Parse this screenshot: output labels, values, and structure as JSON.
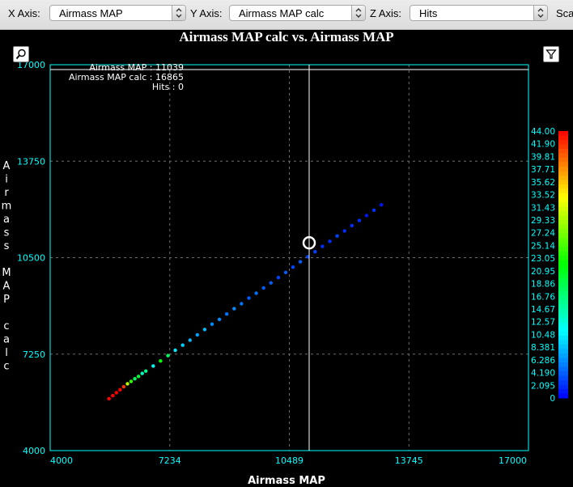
{
  "toolbar": {
    "x_label": "X Axis:",
    "x_value": "Airmass MAP",
    "y_label": "Y Axis:",
    "y_value": "Airmass MAP calc",
    "z_label": "Z Axis:",
    "z_value": "Hits",
    "scale_label": "Sca"
  },
  "icons": {
    "zoom": "zoom-icon",
    "filter": "filter-icon"
  },
  "colors": {
    "axis": "#00ffff",
    "grid": "#6e6e6e",
    "text": "#ffffff",
    "crosshair": "#ffffff"
  },
  "cursor": {
    "lines": [
      "Airmass MAP : 11039",
      "Airmass MAP calc : 16865",
      "Hits : 0"
    ],
    "x": 11039,
    "y": 16865
  },
  "chart_data": {
    "type": "scatter",
    "title": "Airmass MAP calc vs. Airmass MAP",
    "xlabel": "Airmass MAP",
    "ylabel": "Airmass MAP calc",
    "xlim": [
      4000,
      17000
    ],
    "ylim": [
      4000,
      17000
    ],
    "x_ticks": [
      "4000",
      "7234",
      "10489",
      "13745",
      "17000"
    ],
    "y_ticks": [
      "4000",
      "7250",
      "10500",
      "13750",
      "17000"
    ],
    "grid": true,
    "marker_x": 11039,
    "marker_y": 11000,
    "colorbar": {
      "label": "Hits",
      "min": 0,
      "max": 44,
      "ticks": [
        "44.00",
        "41.90",
        "39.81",
        "37.71",
        "35.62",
        "33.52",
        "31.43",
        "29.33",
        "27.24",
        "25.14",
        "23.05",
        "20.95",
        "18.86",
        "16.76",
        "14.67",
        "12.57",
        "10.48",
        "8.381",
        "6.286",
        "4.190",
        "2.095",
        "0"
      ]
    },
    "series": [
      {
        "x": [
          5600,
          5700,
          5800,
          5900,
          6000
        ],
        "y": [
          5750,
          5850,
          5950,
          6050,
          6150
        ],
        "z": [
          44,
          44,
          44,
          44,
          42
        ]
      },
      {
        "x": [
          6100,
          6200,
          6300,
          6400,
          6500
        ],
        "y": [
          6250,
          6330,
          6420,
          6500,
          6600
        ],
        "z": [
          30,
          24,
          18,
          20,
          14
        ]
      },
      {
        "x": [
          6600,
          6800,
          7000,
          7200,
          7400
        ],
        "y": [
          6680,
          6850,
          7020,
          7200,
          7380
        ],
        "z": [
          16,
          12,
          22,
          18,
          10
        ]
      },
      {
        "x": [
          7600,
          7800,
          8000,
          8200,
          8400
        ],
        "y": [
          7550,
          7720,
          7900,
          8080,
          8260
        ],
        "z": [
          9,
          8,
          7,
          8,
          6
        ]
      },
      {
        "x": [
          8600,
          8800,
          9000,
          9200,
          9400
        ],
        "y": [
          8420,
          8600,
          8780,
          8950,
          9140
        ],
        "z": [
          6,
          5,
          6,
          5,
          4
        ]
      },
      {
        "x": [
          9600,
          9800,
          10000,
          10200,
          10400
        ],
        "y": [
          9300,
          9480,
          9650,
          9830,
          10000
        ],
        "z": [
          5,
          4,
          4,
          3,
          4
        ]
      },
      {
        "x": [
          10600,
          10800,
          11000,
          11200,
          11400
        ],
        "y": [
          10180,
          10360,
          10530,
          10700,
          10880
        ],
        "z": [
          3,
          4,
          3,
          3,
          2
        ]
      },
      {
        "x": [
          11600,
          11800,
          12000,
          12200,
          12400,
          12600,
          12800,
          13000
        ],
        "y": [
          11050,
          11230,
          11400,
          11580,
          11750,
          11920,
          12100,
          12280
        ],
        "z": [
          2,
          3,
          2,
          2,
          2,
          1,
          2,
          1
        ]
      }
    ]
  }
}
